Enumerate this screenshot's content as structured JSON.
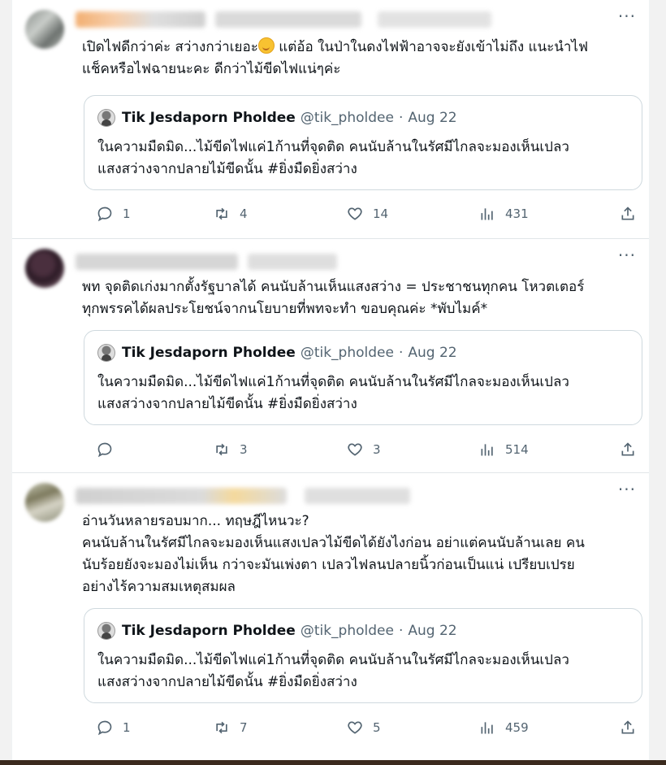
{
  "colors": {
    "text": "#0f1419",
    "secondary": "#536471",
    "border": "#cfd9de"
  },
  "tweets": [
    {
      "text_line1": "เปิดไฟดีกว่าค่ะ สว่างกว่าเยอะ",
      "text_line1_rest": " แต่อ้อ ในป่าในดงไฟฟ้าอาจจะยังเข้าไม่ถึง แนะนำไฟ",
      "emoji": "smiling-face-emoji",
      "text_line2": "แช็คหรือไฟฉายนะคะ ดีกว่าไม้ขีดไฟแน่ๆค่ะ",
      "quote": {
        "name": "Tik Jesdaporn Pholdee",
        "handle": "@tik_pholdee",
        "dot": "·",
        "date": "Aug 22",
        "text": "ในความมืดมิด...ไม้ขีดไฟแค่1ก้านที่จุดติด คนนับล้านในรัศมีไกลจะมองเห็นเปลว\nแสงสว่างจากปลายไม้ขีดนั้น #ยิ่งมืดยิ่งสว่าง"
      },
      "replies": "1",
      "retweets": "4",
      "likes": "14",
      "views": "431"
    },
    {
      "text": "พท จุดติดเก่งมากตั้งรัฐบาลได้ คนนับล้านเห็นแสงสว่าง = ประชาชนทุกคน โหวตเตอร์\nทุกพรรคได้ผลประโยชน์จากนโยบายที่พทจะทำ ขอบคุณค่ะ *พับไมค์*",
      "quote": {
        "name": "Tik Jesdaporn Pholdee",
        "handle": "@tik_pholdee",
        "dot": "·",
        "date": "Aug 22",
        "text": "ในความมืดมิด...ไม้ขีดไฟแค่1ก้านที่จุดติด คนนับล้านในรัศมีไกลจะมองเห็นเปลว\nแสงสว่างจากปลายไม้ขีดนั้น #ยิ่งมืดยิ่งสว่าง"
      },
      "replies": "",
      "retweets": "3",
      "likes": "3",
      "views": "514"
    },
    {
      "text": "อ่านวันหลายรอบมาก... ทฤษฎีไหนวะ?\nคนนับล้านในรัศมีไกลจะมองเห็นแสงเปลวไม้ขีดได้ยังไงก่อน อย่าแต่คนนับล้านเลย คน\nนับร้อยยังจะมองไม่เห็น กว่าจะมันเพ่งตา เปลวไฟลนปลายนิ้วก่อนเป็นแน่ เปรียบเปรย\nอย่างไร้ความสมเหตุสมผล",
      "quote": {
        "name": "Tik Jesdaporn Pholdee",
        "handle": "@tik_pholdee",
        "dot": "·",
        "date": "Aug 22",
        "text": "ในความมืดมิด...ไม้ขีดไฟแค่1ก้านที่จุดติด คนนับล้านในรัศมีไกลจะมองเห็นเปลว\nแสงสว่างจากปลายไม้ขีดนั้น #ยิ่งมืดยิ่งสว่าง"
      },
      "replies": "1",
      "retweets": "7",
      "likes": "5",
      "views": "459"
    }
  ],
  "more_label": "···"
}
